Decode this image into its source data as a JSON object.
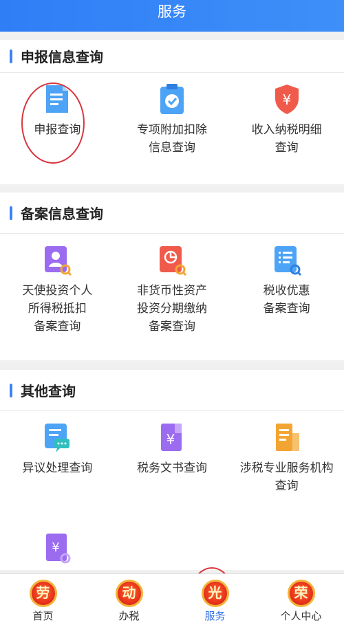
{
  "header": {
    "title": "服务"
  },
  "sections": [
    {
      "title": "申报信息查询",
      "items": [
        {
          "label": "申报查询",
          "icon": "document-icon"
        },
        {
          "label": "专项附加扣除\n信息查询",
          "icon": "clipboard-check-icon"
        },
        {
          "label": "收入纳税明细\n查询",
          "icon": "yen-shield-icon"
        }
      ]
    },
    {
      "title": "备案信息查询",
      "items": [
        {
          "label": "天使投资个人\n所得税抵扣\n备案查询",
          "icon": "person-search-icon"
        },
        {
          "label": "非货币性资产\n投资分期缴纳\n备案查询",
          "icon": "chart-search-icon"
        },
        {
          "label": "税收优惠\n备案查询",
          "icon": "list-search-icon"
        }
      ]
    },
    {
      "title": "其他查询",
      "items": [
        {
          "label": "异议处理查询",
          "icon": "message-doc-icon"
        },
        {
          "label": "税务文书查询",
          "icon": "yen-book-icon"
        },
        {
          "label": "涉税专业服务机构\n查询",
          "icon": "building-doc-icon"
        },
        {
          "label": "",
          "icon": "yen-search-icon"
        }
      ]
    }
  ],
  "tabbar": [
    {
      "label": "首页",
      "medal": "劳"
    },
    {
      "label": "办税",
      "medal": "动"
    },
    {
      "label": "服务",
      "medal": "光",
      "active": true
    },
    {
      "label": "个人中心",
      "medal": "荣"
    }
  ],
  "colors": {
    "accent": "#3b82f6",
    "header": "#2f7ef6",
    "highlight_circle": "#d9363e",
    "medal": "#e8331c"
  }
}
